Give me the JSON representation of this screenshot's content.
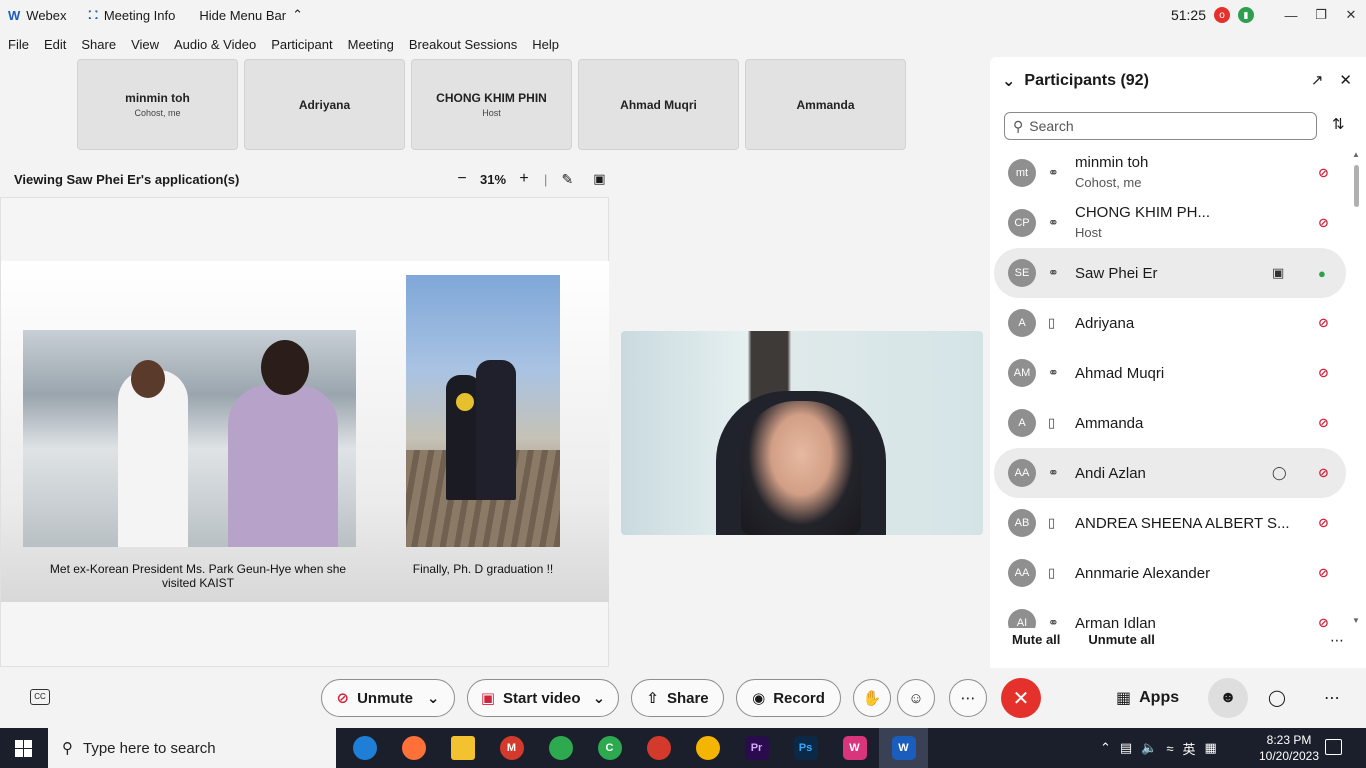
{
  "titlebar": {
    "app": "Webex",
    "meeting_info": "Meeting Info",
    "hide_menu": "Hide Menu Bar",
    "timer": "51:25"
  },
  "menu": [
    "File",
    "Edit",
    "Share",
    "View",
    "Audio & Video",
    "Participant",
    "Meeting",
    "Breakout Sessions",
    "Help"
  ],
  "tiles": [
    {
      "name": "minmin toh",
      "role": "Cohost, me"
    },
    {
      "name": "Adriyana",
      "role": ""
    },
    {
      "name": "CHONG KHIM PHIN",
      "role": "Host"
    },
    {
      "name": "Ahmad Muqri",
      "role": ""
    },
    {
      "name": "Ammanda",
      "role": ""
    }
  ],
  "share": {
    "viewing": "Viewing Saw Phei Er's application(s)",
    "zoom": "31%",
    "caption1": "Met ex-Korean President Ms. Park Geun-Hye when she visited KAIST",
    "caption2": "Finally, Ph. D graduation !!"
  },
  "panel": {
    "title": "Participants (92)",
    "search_placeholder": "Search",
    "mute_all": "Mute all",
    "unmute_all": "Unmute all",
    "participants": [
      {
        "initials": "mt",
        "name": "minmin toh",
        "role": "Cohost, me",
        "device": "headset",
        "mic": "muted",
        "highlight": false,
        "extra": ""
      },
      {
        "initials": "CP",
        "name": "CHONG KHIM PH...",
        "role": "Host",
        "device": "headset",
        "mic": "muted",
        "highlight": false,
        "extra": ""
      },
      {
        "initials": "SE",
        "name": "Saw Phei Er",
        "role": "",
        "device": "headset",
        "mic": "on",
        "highlight": true,
        "extra": "video"
      },
      {
        "initials": "A",
        "name": "Adriyana",
        "role": "",
        "device": "phone",
        "mic": "muted",
        "highlight": false,
        "extra": ""
      },
      {
        "initials": "AM",
        "name": "Ahmad Muqri",
        "role": "",
        "device": "headset",
        "mic": "muted",
        "highlight": false,
        "extra": ""
      },
      {
        "initials": "A",
        "name": "Ammanda",
        "role": "",
        "device": "phone",
        "mic": "muted",
        "highlight": false,
        "extra": ""
      },
      {
        "initials": "AA",
        "name": "Andi Azlan",
        "role": "",
        "device": "headset",
        "mic": "muted",
        "highlight": true,
        "extra": "chat"
      },
      {
        "initials": "AB",
        "name": "ANDREA SHEENA ALBERT S...",
        "role": "",
        "device": "phone",
        "mic": "muted",
        "highlight": false,
        "extra": ""
      },
      {
        "initials": "AA",
        "name": "Annmarie Alexander",
        "role": "",
        "device": "phone",
        "mic": "muted",
        "highlight": false,
        "extra": ""
      },
      {
        "initials": "AI",
        "name": "Arman Idlan",
        "role": "",
        "device": "headset",
        "mic": "muted",
        "highlight": false,
        "extra": ""
      }
    ]
  },
  "controls": {
    "unmute": "Unmute",
    "start_video": "Start video",
    "share": "Share",
    "record": "Record",
    "apps": "Apps"
  },
  "taskbar": {
    "search_placeholder": "Type here to search",
    "time": "8:23 PM",
    "date": "10/20/2023",
    "ime": "英",
    "apps": [
      {
        "name": "edge-icon",
        "label": "",
        "color": "#1f7fd6"
      },
      {
        "name": "firefox-icon",
        "label": "",
        "color": "#ff7139"
      },
      {
        "name": "file-explorer-icon",
        "label": "",
        "color": "#f2c231"
      },
      {
        "name": "chrome-profile-m-icon",
        "label": "M",
        "color": "#d33a2c"
      },
      {
        "name": "chrome-profile-2-icon",
        "label": "",
        "color": "#2da94f"
      },
      {
        "name": "chrome-profile-c-icon",
        "label": "C",
        "color": "#2da94f"
      },
      {
        "name": "chrome-profile-3-icon",
        "label": "",
        "color": "#d33a2c"
      },
      {
        "name": "chrome-icon",
        "label": "",
        "color": "#f4b400"
      },
      {
        "name": "premiere-icon",
        "label": "Pr",
        "color": "#2a0b4d"
      },
      {
        "name": "photoshop-icon",
        "label": "Ps",
        "color": "#0b2847"
      },
      {
        "name": "wps-icon",
        "label": "W",
        "color": "#d8357d"
      },
      {
        "name": "webex-icon",
        "label": "W",
        "color": "#1b5dbd"
      }
    ]
  }
}
